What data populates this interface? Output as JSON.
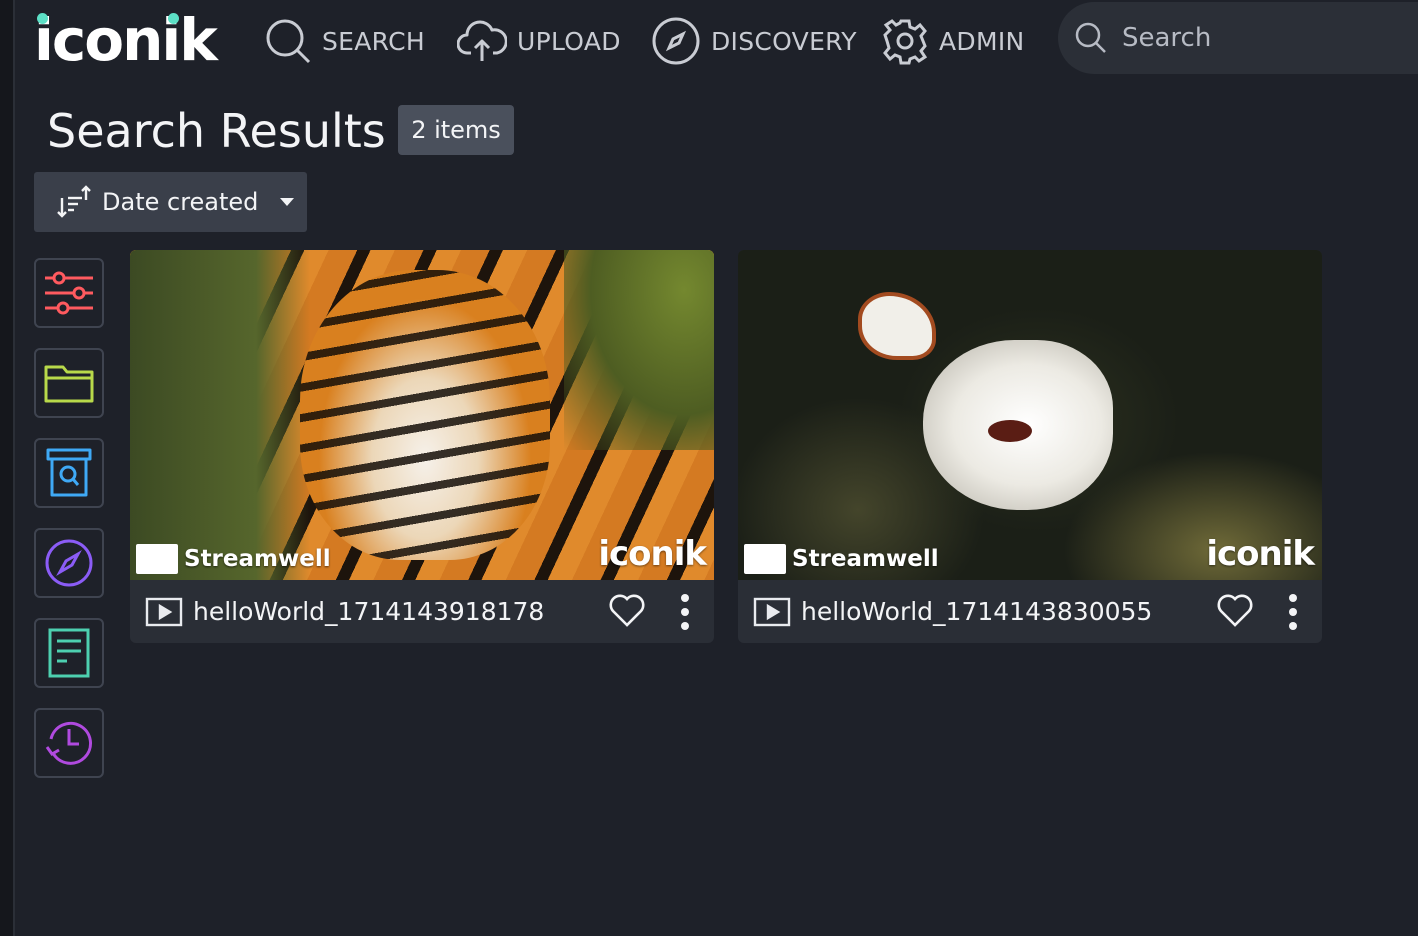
{
  "app": {
    "logo_text": "iconik"
  },
  "nav": [
    {
      "label": "SEARCH",
      "icon": "search-icon"
    },
    {
      "label": "UPLOAD",
      "icon": "cloud-upload-icon"
    },
    {
      "label": "DISCOVERY",
      "icon": "compass-icon"
    },
    {
      "label": "ADMIN",
      "icon": "gear-icon"
    }
  ],
  "search": {
    "placeholder": "Search",
    "value": ""
  },
  "page": {
    "title": "Search Results",
    "count_label": "2 items"
  },
  "sort": {
    "label": "Date created"
  },
  "sidebar": [
    {
      "name": "filters",
      "icon": "sliders-icon",
      "color": "#ff5a5f"
    },
    {
      "name": "collections",
      "icon": "folder-icon",
      "color": "#b8d94a"
    },
    {
      "name": "saved-searches",
      "icon": "archive-search-icon",
      "color": "#3fa9f5"
    },
    {
      "name": "discovery",
      "icon": "compass-icon",
      "color": "#8b5cf6"
    },
    {
      "name": "metadata",
      "icon": "document-icon",
      "color": "#4dd0b0"
    },
    {
      "name": "history",
      "icon": "history-icon",
      "color": "#b04adf"
    }
  ],
  "results": [
    {
      "title": "helloWorld_1714143918178",
      "type_icon": "video-icon",
      "watermark_left": "Streamwell",
      "watermark_right": "iconik"
    },
    {
      "title": "helloWorld_1714143830055",
      "type_icon": "video-icon",
      "watermark_left": "Streamwell",
      "watermark_right": "iconik"
    }
  ],
  "colors": {
    "background": "#1e2129",
    "accent": "#5ce0c6",
    "card": "#2a2e36"
  }
}
